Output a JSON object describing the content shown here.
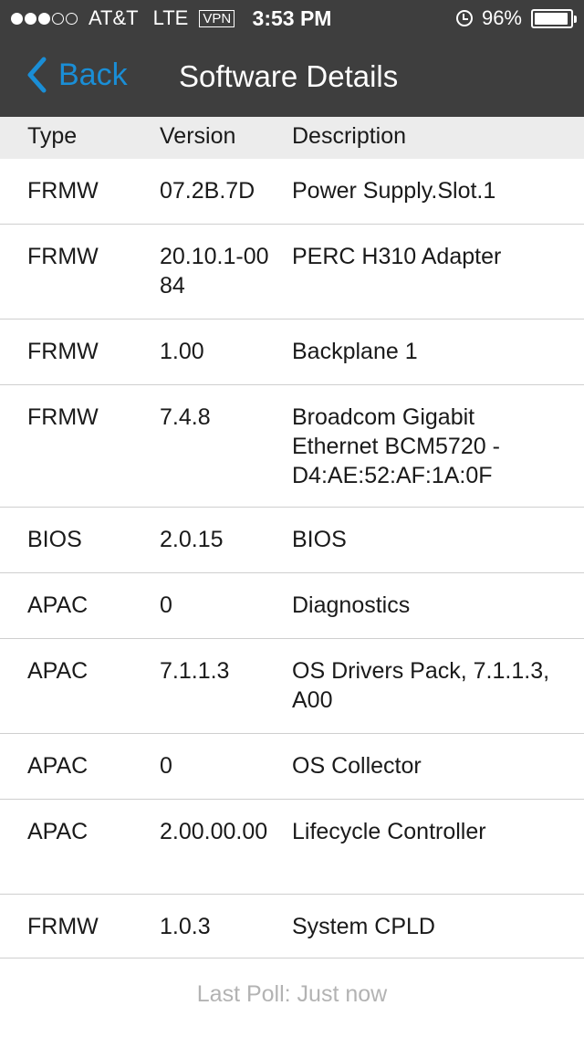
{
  "status_bar": {
    "carrier": "AT&T",
    "network": "LTE",
    "vpn": "VPN",
    "time": "3:53 PM",
    "battery": "96%",
    "battery_level": 0.96,
    "signal_bars_filled": 3,
    "signal_bars_total": 5
  },
  "nav": {
    "back_label": "Back",
    "title": "Software Details"
  },
  "table": {
    "columns": [
      "Type",
      "Version",
      "Description"
    ],
    "rows": [
      {
        "type": "FRMW",
        "version": "07.2B.7D",
        "description": "Power Supply.Slot.1"
      },
      {
        "type": "FRMW",
        "version": "20.10.1-0084",
        "description": "PERC H310 Adapter"
      },
      {
        "type": "FRMW",
        "version": "1.00",
        "description": "Backplane 1"
      },
      {
        "type": "FRMW",
        "version": "7.4.8",
        "description": "Broadcom Gigabit Ethernet BCM5720 - D4:AE:52:AF:1A:0F"
      },
      {
        "type": "BIOS",
        "version": "2.0.15",
        "description": "BIOS"
      },
      {
        "type": "APAC",
        "version": "0",
        "description": "Diagnostics"
      },
      {
        "type": "APAC",
        "version": "7.1.1.3",
        "description": "OS Drivers Pack, 7.1.1.3, A00"
      },
      {
        "type": "APAC",
        "version": "0",
        "description": "OS Collector"
      },
      {
        "type": "APAC",
        "version": "2.00.00.00",
        "description": "Lifecycle Controller"
      },
      {
        "type": "FRMW",
        "version": "1.0.3",
        "description": "System CPLD"
      }
    ]
  },
  "footer": {
    "last_poll": "Last Poll: Just now"
  },
  "colors": {
    "nav_background": "#3e3e3e",
    "accent": "#1a8ed6",
    "header_row_background": "#ececec"
  }
}
